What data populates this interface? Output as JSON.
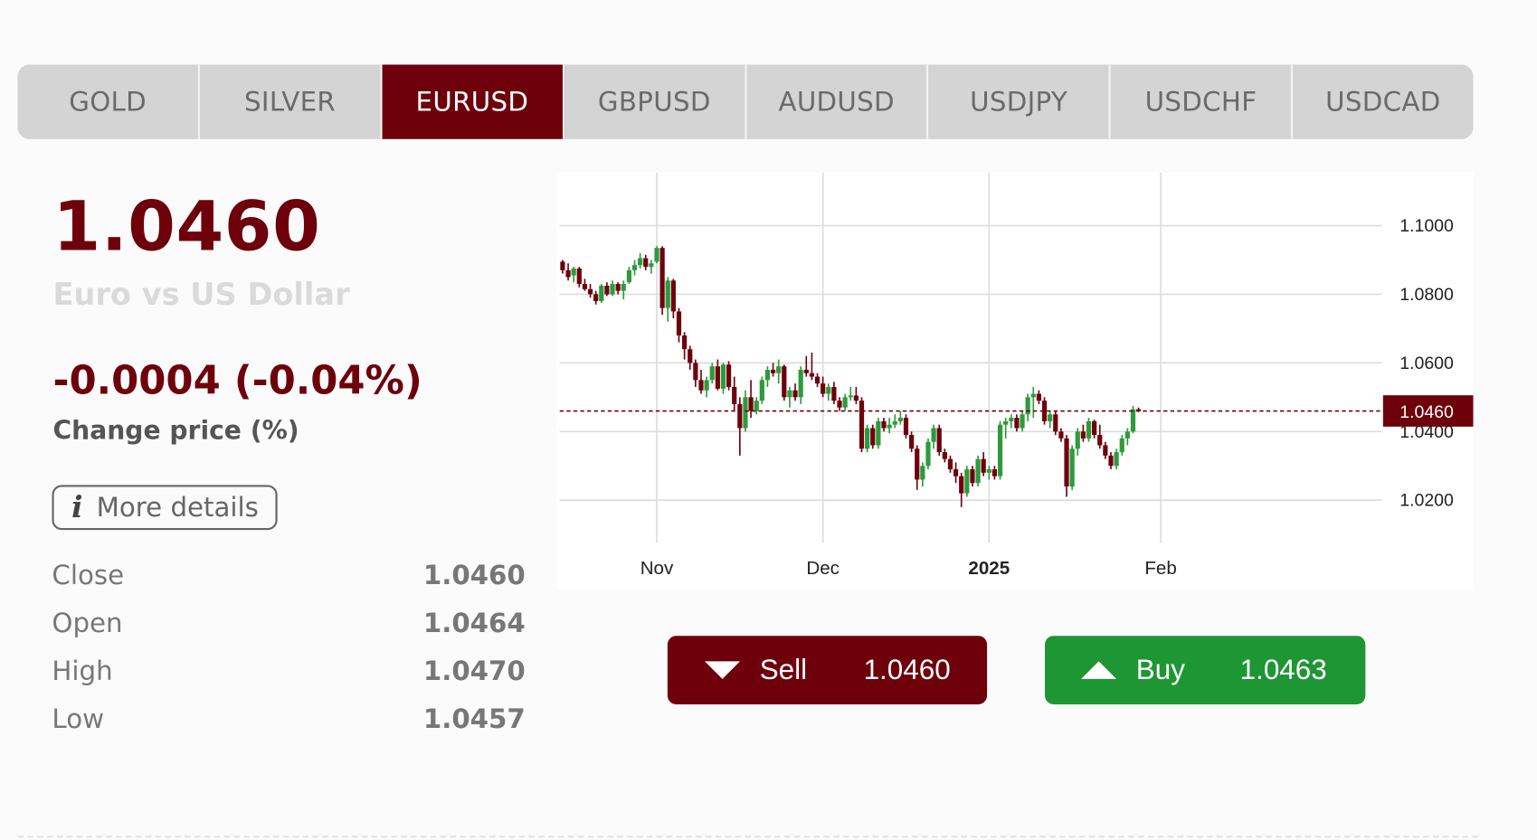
{
  "tabs": [
    {
      "label": "GOLD",
      "active": false
    },
    {
      "label": "SILVER",
      "active": false
    },
    {
      "label": "EURUSD",
      "active": true
    },
    {
      "label": "GBPUSD",
      "active": false
    },
    {
      "label": "AUDUSD",
      "active": false
    },
    {
      "label": "USDJPY",
      "active": false
    },
    {
      "label": "USDCHF",
      "active": false
    },
    {
      "label": "USDCAD",
      "active": false
    }
  ],
  "quote": {
    "price": "1.0460",
    "name": "Euro vs US Dollar",
    "change": "-0.0004 (-0.04%)",
    "change_label": "Change price (%)"
  },
  "details_button": {
    "label": "More details",
    "icon": "info-icon"
  },
  "stats": [
    {
      "label": "Close",
      "value": "1.0460"
    },
    {
      "label": "Open",
      "value": "1.0464"
    },
    {
      "label": "High",
      "value": "1.0470"
    },
    {
      "label": "Low",
      "value": "1.0457"
    }
  ],
  "sell": {
    "label": "Sell",
    "price": "1.0460"
  },
  "buy": {
    "label": "Buy",
    "price": "1.0463"
  },
  "colors": {
    "accent": "#6e000c",
    "up": "#2e9a3c",
    "down": "#6e000c",
    "buy": "#1e9634"
  },
  "chart_data": {
    "type": "candlestick",
    "x_labels": [
      {
        "label": "Nov",
        "index": 17,
        "bold": false
      },
      {
        "label": "Dec",
        "index": 47,
        "bold": false
      },
      {
        "label": "2025",
        "index": 77,
        "bold": true
      },
      {
        "label": "Feb",
        "index": 108,
        "bold": false
      }
    ],
    "yticks": [
      "1.1000",
      "1.0800",
      "1.0600",
      "1.0400",
      "1.0200"
    ],
    "ytick_values": [
      1.1,
      1.08,
      1.06,
      1.04,
      1.02
    ],
    "ylim": [
      1.0076,
      1.1155
    ],
    "current_price": 1.046,
    "current_label": "1.0460",
    "grid": true,
    "candles": [
      [
        1.0895,
        1.09,
        1.086,
        1.087
      ],
      [
        1.087,
        1.089,
        1.084,
        1.085
      ],
      [
        1.0855,
        1.088,
        1.0835,
        1.0875
      ],
      [
        1.0875,
        1.088,
        1.082,
        1.083
      ],
      [
        1.083,
        1.0845,
        1.081,
        1.0815
      ],
      [
        1.0815,
        1.083,
        1.079,
        1.08
      ],
      [
        1.08,
        1.081,
        1.077,
        1.078
      ],
      [
        1.078,
        1.083,
        1.0775,
        1.0825
      ],
      [
        1.0825,
        1.0835,
        1.0795,
        1.08
      ],
      [
        1.08,
        1.084,
        1.0795,
        1.083
      ],
      [
        1.083,
        1.0835,
        1.08,
        1.081
      ],
      [
        1.081,
        1.084,
        1.0785,
        1.083
      ],
      [
        1.0835,
        1.088,
        1.083,
        1.087
      ],
      [
        1.087,
        1.09,
        1.0855,
        1.0885
      ],
      [
        1.0885,
        1.092,
        1.0875,
        1.0905
      ],
      [
        1.0905,
        1.0915,
        1.087,
        1.088
      ],
      [
        1.088,
        1.09,
        1.086,
        1.089
      ],
      [
        1.0895,
        1.094,
        1.089,
        1.0935
      ],
      [
        1.0935,
        1.094,
        1.074,
        1.076
      ],
      [
        1.076,
        1.085,
        1.072,
        1.084
      ],
      [
        1.084,
        1.0845,
        1.073,
        1.075
      ],
      [
        1.075,
        1.076,
        1.066,
        1.068
      ],
      [
        1.068,
        1.069,
        1.061,
        1.064
      ],
      [
        1.064,
        1.065,
        1.058,
        1.06
      ],
      [
        1.06,
        1.061,
        1.053,
        1.055
      ],
      [
        1.055,
        1.058,
        1.051,
        1.052
      ],
      [
        1.052,
        1.056,
        1.05,
        1.055
      ],
      [
        1.055,
        1.06,
        1.054,
        1.059
      ],
      [
        1.059,
        1.061,
        1.052,
        1.0525
      ],
      [
        1.0525,
        1.06,
        1.051,
        1.0595
      ],
      [
        1.0595,
        1.0605,
        1.052,
        1.053
      ],
      [
        1.053,
        1.056,
        1.046,
        1.048
      ],
      [
        1.048,
        1.05,
        1.033,
        1.041
      ],
      [
        1.041,
        1.052,
        1.04,
        1.05
      ],
      [
        1.05,
        1.055,
        1.044,
        1.046
      ],
      [
        1.046,
        1.05,
        1.045,
        1.049
      ],
      [
        1.049,
        1.056,
        1.048,
        1.055
      ],
      [
        1.055,
        1.059,
        1.053,
        1.058
      ],
      [
        1.058,
        1.06,
        1.056,
        1.057
      ],
      [
        1.057,
        1.061,
        1.054,
        1.059
      ],
      [
        1.059,
        1.0595,
        1.049,
        1.05
      ],
      [
        1.05,
        1.053,
        1.047,
        1.052
      ],
      [
        1.052,
        1.054,
        1.049,
        1.05
      ],
      [
        1.05,
        1.059,
        1.048,
        1.058
      ],
      [
        1.058,
        1.062,
        1.056,
        1.057
      ],
      [
        1.057,
        1.063,
        1.055,
        1.056
      ],
      [
        1.056,
        1.057,
        1.053,
        1.054
      ],
      [
        1.054,
        1.056,
        1.05,
        1.051
      ],
      [
        1.051,
        1.054,
        1.049,
        1.053
      ],
      [
        1.053,
        1.0545,
        1.048,
        1.049
      ],
      [
        1.049,
        1.05,
        1.046,
        1.047
      ],
      [
        1.047,
        1.051,
        1.046,
        1.05
      ],
      [
        1.05,
        1.053,
        1.049,
        1.0505
      ],
      [
        1.0505,
        1.053,
        1.048,
        1.049
      ],
      [
        1.049,
        1.05,
        1.034,
        1.035
      ],
      [
        1.035,
        1.042,
        1.034,
        1.041
      ],
      [
        1.041,
        1.042,
        1.035,
        1.036
      ],
      [
        1.036,
        1.044,
        1.035,
        1.043
      ],
      [
        1.043,
        1.044,
        1.04,
        1.041
      ],
      [
        1.041,
        1.044,
        1.0395,
        1.042
      ],
      [
        1.042,
        1.045,
        1.041,
        1.043
      ],
      [
        1.043,
        1.046,
        1.042,
        1.044
      ],
      [
        1.044,
        1.045,
        1.038,
        1.039
      ],
      [
        1.039,
        1.04,
        1.034,
        1.035
      ],
      [
        1.035,
        1.036,
        1.023,
        1.026
      ],
      [
        1.026,
        1.031,
        1.024,
        1.03
      ],
      [
        1.03,
        1.038,
        1.029,
        1.037
      ],
      [
        1.037,
        1.042,
        1.035,
        1.041
      ],
      [
        1.041,
        1.042,
        1.033,
        1.034
      ],
      [
        1.034,
        1.035,
        1.031,
        1.032
      ],
      [
        1.032,
        1.033,
        1.028,
        1.029
      ],
      [
        1.029,
        1.031,
        1.025,
        1.027
      ],
      [
        1.027,
        1.028,
        1.018,
        1.022
      ],
      [
        1.022,
        1.03,
        1.021,
        1.029
      ],
      [
        1.029,
        1.03,
        1.024,
        1.025
      ],
      [
        1.025,
        1.033,
        1.024,
        1.032
      ],
      [
        1.032,
        1.034,
        1.027,
        1.028
      ],
      [
        1.028,
        1.03,
        1.026,
        1.029
      ],
      [
        1.029,
        1.03,
        1.026,
        1.027
      ],
      [
        1.027,
        1.043,
        1.026,
        1.042
      ],
      [
        1.042,
        1.044,
        1.038,
        1.043
      ],
      [
        1.043,
        1.045,
        1.041,
        1.044
      ],
      [
        1.044,
        1.045,
        1.04,
        1.041
      ],
      [
        1.041,
        1.046,
        1.04,
        1.045
      ],
      [
        1.045,
        1.051,
        1.043,
        1.05
      ],
      [
        1.05,
        1.053,
        1.044,
        1.051
      ],
      [
        1.051,
        1.052,
        1.048,
        1.049
      ],
      [
        1.049,
        1.05,
        1.042,
        1.043
      ],
      [
        1.043,
        1.046,
        1.041,
        1.045
      ],
      [
        1.045,
        1.046,
        1.039,
        1.04
      ],
      [
        1.04,
        1.041,
        1.037,
        1.038
      ],
      [
        1.038,
        1.039,
        1.021,
        1.024
      ],
      [
        1.024,
        1.036,
        1.023,
        1.035
      ],
      [
        1.035,
        1.041,
        1.033,
        1.04
      ],
      [
        1.04,
        1.042,
        1.037,
        1.038
      ],
      [
        1.038,
        1.044,
        1.037,
        1.043
      ],
      [
        1.043,
        1.0435,
        1.038,
        1.039
      ],
      [
        1.039,
        1.042,
        1.035,
        1.036
      ],
      [
        1.036,
        1.037,
        1.032,
        1.033
      ],
      [
        1.033,
        1.034,
        1.029,
        1.03
      ],
      [
        1.03,
        1.035,
        1.029,
        1.034
      ],
      [
        1.034,
        1.039,
        1.033,
        1.038
      ],
      [
        1.038,
        1.041,
        1.036,
        1.04
      ],
      [
        1.04,
        1.0475,
        1.0395,
        1.0465
      ],
      [
        1.0465,
        1.047,
        1.0457,
        1.046
      ]
    ]
  }
}
